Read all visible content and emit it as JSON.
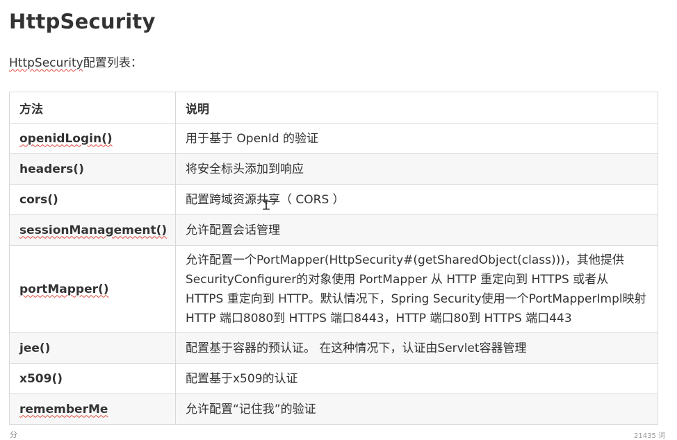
{
  "page": {
    "title": "HttpSecurity",
    "intro_prefix": "HttpSecurity",
    "intro_suffix": "配置列表："
  },
  "table": {
    "headers": [
      "方法",
      "说明"
    ],
    "rows": [
      {
        "method": "openidLogin()",
        "description": "用于基于 OpenId 的验证"
      },
      {
        "method": "headers()",
        "description": "将安全标头添加到响应"
      },
      {
        "method": "cors()",
        "description": "配置跨域资源共享（ CORS ）"
      },
      {
        "method": "sessionManagement()",
        "description": "允许配置会话管理"
      },
      {
        "method": "portMapper()",
        "description": "允许配置一个PortMapper(HttpSecurity#(getSharedObject(class)))，其他提供SecurityConfigurer的对象使用 PortMapper 从 HTTP 重定向到 HTTPS 或者从 HTTPS 重定向到 HTTP。默认情况下，Spring Security使用一个PortMapperImpl映射 HTTP 端口8080到 HTTPS 端口8443，HTTP 端口80到 HTTPS 端口443"
      },
      {
        "method": "jee()",
        "description": "配置基于容器的预认证。 在这种情况下，认证由Servlet容器管理"
      },
      {
        "method": "x509()",
        "description": "配置基于x509的认证"
      },
      {
        "method": "rememberMe",
        "description": "允许配置“记住我”的验证"
      }
    ]
  },
  "footer": {
    "left": "分",
    "right": "21435 词"
  },
  "colors": {
    "text": "#333333",
    "border": "#d8d8d8",
    "row_alt": "#f7f7f7",
    "spellcheck": "#e0473a"
  }
}
